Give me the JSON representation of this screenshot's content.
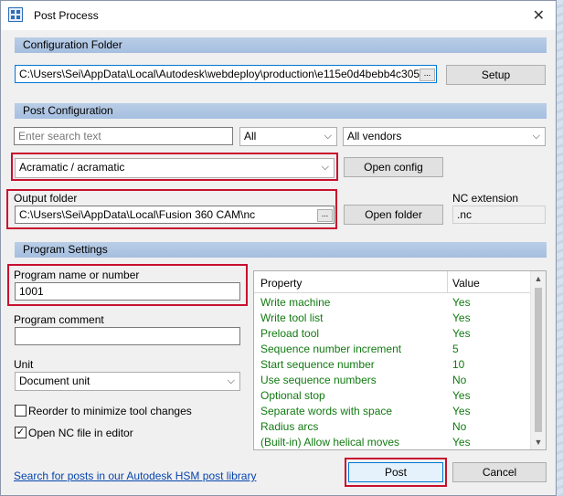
{
  "window": {
    "title": "Post Process",
    "icon": "post-process-app-icon"
  },
  "config_folder": {
    "heading": "Configuration Folder",
    "path": "C:\\Users\\Sei\\AppData\\Local\\Autodesk\\webdeploy\\production\\e115e0d4bebb4c305",
    "browse": "...",
    "setup": "Setup"
  },
  "post_config": {
    "heading": "Post Configuration",
    "search_placeholder": "Enter search text",
    "filter1": "All",
    "filter2": "All vendors",
    "selected_post": "Acramatic / acramatic",
    "open_config": "Open config",
    "output_folder_label": "Output folder",
    "output_folder": "C:\\Users\\Sei\\AppData\\Local\\Fusion 360 CAM\\nc",
    "browse": "...",
    "open_folder": "Open folder",
    "nc_extension_label": "NC extension",
    "nc_extension": ".nc"
  },
  "program_settings": {
    "heading": "Program Settings",
    "program_name_label": "Program name or number",
    "program_name": "1001",
    "comment_label": "Program comment",
    "comment": "",
    "unit_label": "Unit",
    "unit": "Document unit",
    "reorder_label": "Reorder to minimize tool changes",
    "reorder_checked": false,
    "open_nc_label": "Open NC file in editor",
    "open_nc_checked": true,
    "check_mark": "✓"
  },
  "properties": {
    "col_property": "Property",
    "col_value": "Value",
    "rows": [
      {
        "name": "Write machine",
        "value": "Yes"
      },
      {
        "name": "Write tool list",
        "value": "Yes"
      },
      {
        "name": "Preload tool",
        "value": "Yes"
      },
      {
        "name": "Sequence number increment",
        "value": "5"
      },
      {
        "name": "Start sequence number",
        "value": "10"
      },
      {
        "name": "Use sequence numbers",
        "value": "No"
      },
      {
        "name": "Optional stop",
        "value": "Yes"
      },
      {
        "name": "Separate words with space",
        "value": "Yes"
      },
      {
        "name": "Radius arcs",
        "value": "No"
      },
      {
        "name": "(Built-in) Allow helical moves",
        "value": "Yes"
      }
    ]
  },
  "footer": {
    "link": "Search for posts in our Autodesk HSM post library",
    "post": "Post",
    "cancel": "Cancel"
  },
  "colors": {
    "section_header": "#a6bfe0",
    "highlight_red": "#c8102e",
    "property_text": "#117a11",
    "link": "#0645ad"
  }
}
